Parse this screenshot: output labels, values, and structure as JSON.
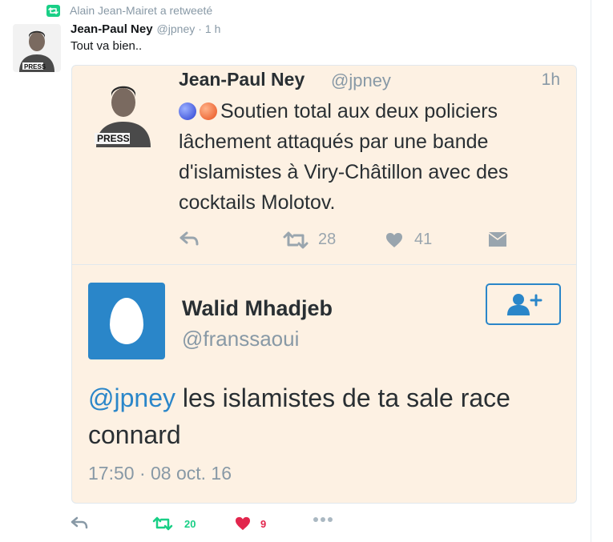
{
  "retweet_context": {
    "text": "Alain Jean-Mairet a retweeté",
    "icon": "retweet-icon"
  },
  "tweet": {
    "author_name": "Jean-Paul Ney",
    "author_handle": "@jpney",
    "separator": "·",
    "time": "1 h",
    "text": "Tout va bien..",
    "avatar_badge": "PRESS",
    "actions": {
      "reply_icon": "reply-icon",
      "retweet_icon": "retweet-icon",
      "retweet_count": "20",
      "like_icon": "heart-icon",
      "like_count": "9",
      "more_icon": "more-icon"
    },
    "colors": {
      "retweet": "#19cf86",
      "like": "#e2264d",
      "muted": "#8899a6"
    }
  },
  "quoted_tweet": {
    "author_name": "Jean-Paul Ney",
    "author_handle": "@jpney",
    "time": "1h",
    "avatar_badge": "PRESS",
    "emoji": [
      "blue-circle",
      "orange-circle"
    ],
    "text": "Soutien total aux deux policiers lâchement attaqués par une bande d'islamistes à Viry-Châtillon avec des cocktails Molotov.",
    "actions": {
      "reply_icon": "reply-icon",
      "retweet_icon": "retweet-icon",
      "retweet_count": "28",
      "like_icon": "heart-icon",
      "like_count": "41",
      "dm_icon": "direct-message-icon"
    },
    "background": "#fdf1e3"
  },
  "reply_tweet": {
    "author_name": "Walid Mhadjeb",
    "author_handle": "@franssaoui",
    "mention": "@jpney",
    "text": " les islamistes de ta sale race connard",
    "date": "17:50 · 08 oct. 16",
    "follow_icon": "follow-user-icon",
    "avatar_icon": "default-egg-avatar",
    "accent": "#2a86c9"
  }
}
